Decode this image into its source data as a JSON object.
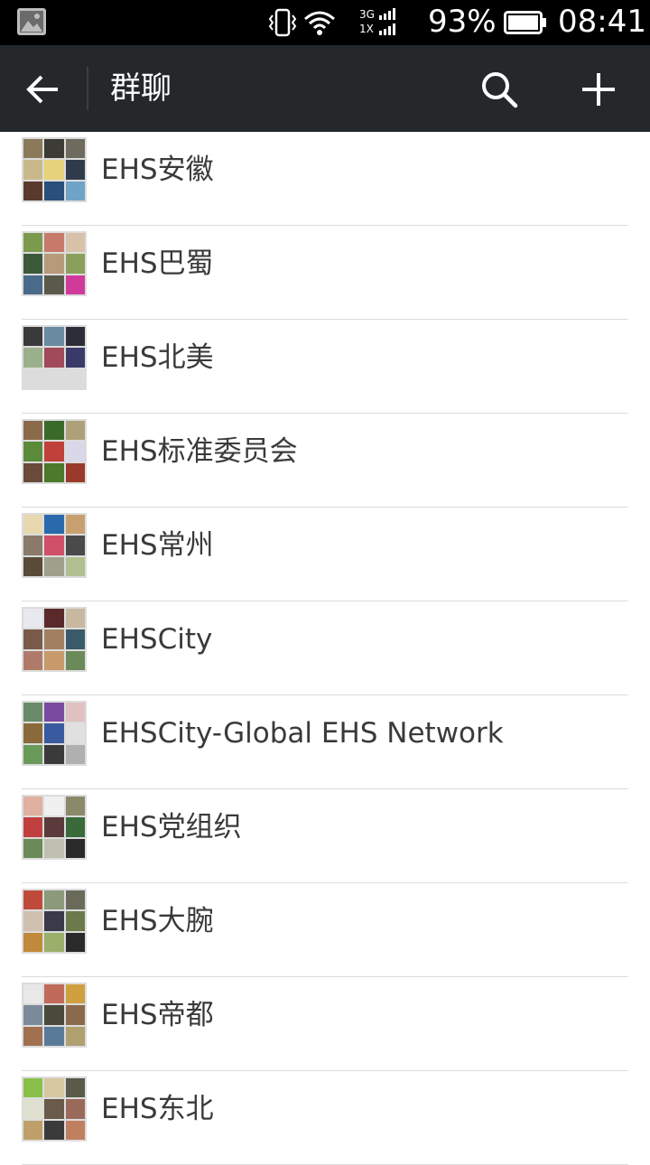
{
  "status_bar": {
    "network_top": "3G",
    "network_bottom": "1X",
    "battery": "93%",
    "time": "08:41"
  },
  "action_bar": {
    "title": "群聊"
  },
  "groups": [
    {
      "name": "EHS安徽",
      "tiles": [
        "#8a7a5a",
        "#3d3b35",
        "#6e6a5e",
        "#c9b98a",
        "#e6d27a",
        "#2f3b4a",
        "#5b3a2e",
        "#2a4f7a",
        "#6fa4c8"
      ]
    },
    {
      "name": "EHS巴蜀",
      "tiles": [
        "#7c9a4e",
        "#c77a6a",
        "#d8c1a8",
        "#3c5a3a",
        "#b79a7a",
        "#8aa05a",
        "#4a6a8a",
        "#5a5a4a",
        "#d03a9a"
      ]
    },
    {
      "name": "EHS北美",
      "tiles": [
        "#3a3a3a",
        "#6a8aa0",
        "#2d2d3a",
        "#9ab08a",
        "#a04a5a",
        "#3a3a6a",
        "#dcdcdc",
        "#dcdcdc",
        "#dcdcdc"
      ]
    },
    {
      "name": "EHS标准委员会",
      "tiles": [
        "#8a6a4a",
        "#3a6a2a",
        "#b0a07a",
        "#5a8a3a",
        "#c0403a",
        "#d8d8e8",
        "#6a4a3a",
        "#4a7a2a",
        "#9a3a2a"
      ]
    },
    {
      "name": "EHS常州",
      "tiles": [
        "#e8d8b0",
        "#2a6aaa",
        "#c8a070",
        "#8a7a6a",
        "#d0506a",
        "#4a4a4a",
        "#5a4a3a",
        "#a0a08a",
        "#b0c090"
      ]
    },
    {
      "name": "EHSCity",
      "tiles": [
        "#e8e8f0",
        "#5a2a2a",
        "#c8b8a0",
        "#7a5a4a",
        "#a08060",
        "#3a5a6a",
        "#b07a6a",
        "#c89a6a",
        "#6a8a5a"
      ]
    },
    {
      "name": "EHSCity-Global EHS Network",
      "tiles": [
        "#6a8a6a",
        "#7a4aa0",
        "#e0c0c0",
        "#8a6a3a",
        "#3a5aa0",
        "#e0e0e0",
        "#6a9a5a",
        "#3a3a3a",
        "#b0b0b0"
      ]
    },
    {
      "name": "EHS党组织",
      "tiles": [
        "#e0b0a0",
        "#f0f0f0",
        "#8a8a6a",
        "#c04040",
        "#5a3a3a",
        "#3a6a3a",
        "#6a8a5a",
        "#c0c0b0",
        "#2a2a2a"
      ]
    },
    {
      "name": "EHS大腕",
      "tiles": [
        "#c04a3a",
        "#8a9a7a",
        "#6a6a5a",
        "#d0c0b0",
        "#3a3a4a",
        "#6a7a4a",
        "#c08a3a",
        "#9ab06a",
        "#2a2a2a"
      ]
    },
    {
      "name": "EHS帝都",
      "tiles": [
        "#e8e8e8",
        "#c06a5a",
        "#d0a040",
        "#7a8a9a",
        "#4a4a3a",
        "#8a6a4a",
        "#a07050",
        "#5a7a9a",
        "#b0a070"
      ]
    },
    {
      "name": "EHS东北",
      "tiles": [
        "#8ac04a",
        "#d8c8a0",
        "#5a5a4a",
        "#e0e0d0",
        "#6a5a4a",
        "#9a6a5a",
        "#c0a06a",
        "#3a3a3a",
        "#c08060"
      ]
    }
  ]
}
